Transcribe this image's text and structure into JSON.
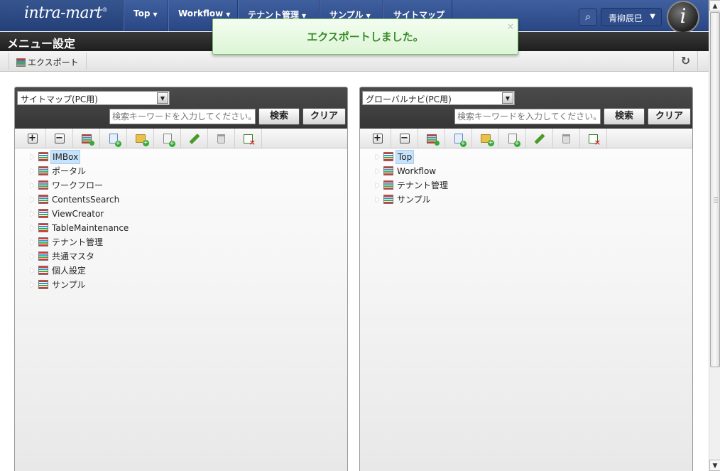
{
  "header": {
    "logo_text": "intra-mart",
    "logo_reg": "®",
    "nav": [
      {
        "label": "Top"
      },
      {
        "label": "Workflow"
      },
      {
        "label": "テナント管理"
      },
      {
        "label": "サンプル"
      },
      {
        "label": "サイトマップ"
      }
    ],
    "search_icon": "search-icon",
    "user_name": "青柳辰巳",
    "logo_badge": "i"
  },
  "page": {
    "title": "メニュー設定"
  },
  "toolbar": {
    "export_label": "エクスポート",
    "refresh_icon": "refresh-icon"
  },
  "toast": {
    "message": "エクスポートしました。",
    "close": "×"
  },
  "left_panel": {
    "selected": "サイトマップ(PC用)",
    "search_placeholder": "検索キーワードを入力してください。",
    "search_label": "検索",
    "clear_label": "クリア",
    "tree": [
      {
        "label": "IMBox",
        "selected": true
      },
      {
        "label": "ポータル"
      },
      {
        "label": "ワークフロー"
      },
      {
        "label": "ContentsSearch"
      },
      {
        "label": "ViewCreator"
      },
      {
        "label": "TableMaintenance"
      },
      {
        "label": "テナント管理"
      },
      {
        "label": "共通マスタ"
      },
      {
        "label": "個人設定"
      },
      {
        "label": "サンプル"
      }
    ]
  },
  "right_panel": {
    "selected": "グローバルナビ(PC用)",
    "search_placeholder": "検索キーワードを入力してください。",
    "search_label": "検索",
    "clear_label": "クリア",
    "tree": [
      {
        "label": "Top",
        "selected": true
      },
      {
        "label": "Workflow"
      },
      {
        "label": "テナント管理"
      },
      {
        "label": "サンプル"
      }
    ]
  },
  "icon_toolbar": [
    "expand-all-icon",
    "collapse-all-icon",
    "add-menu-group-icon",
    "add-page-blue-icon",
    "add-folder-icon",
    "add-page-icon",
    "edit-icon",
    "delete-icon",
    "check-remove-icon"
  ],
  "colors": {
    "nav_bg": "#2f4f8c",
    "title_bg": "#2a2a2a",
    "toast_bg": "#e6f8e0",
    "toast_text": "#3a8a2a",
    "selection": "#c6e3fb"
  }
}
